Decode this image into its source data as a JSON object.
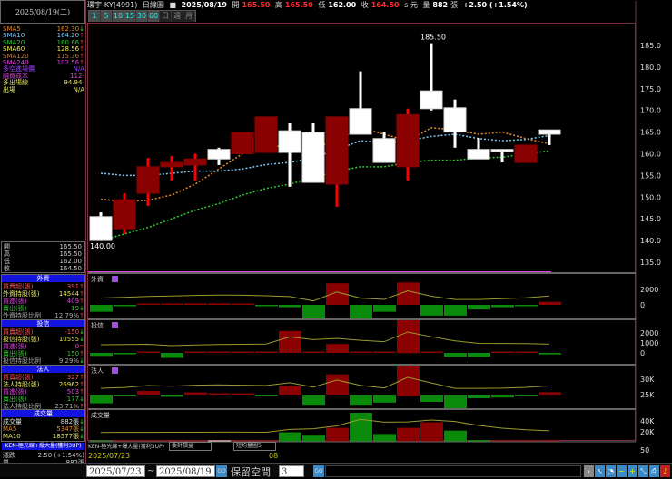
{
  "header": {
    "stock": "環宇-KY(4991)",
    "chart_type": "日線圖",
    "icon": "■",
    "date": "2025/08/19",
    "open_label": "開",
    "open": "165.50",
    "high_label": "高",
    "high": "165.50",
    "low_label": "低",
    "low": "162.00",
    "close_label": "收",
    "close": "164.50",
    "unit": "s 元",
    "vol_label": "量",
    "vol": "882",
    "vol_unit": "張",
    "change": "+2.50 (+1.54%)"
  },
  "periods": [
    "1",
    "5",
    "10",
    "15",
    "30",
    "60",
    "日",
    "週",
    "月"
  ],
  "left": {
    "date": "2025/08/19(二)",
    "ma": [
      {
        "label": "SMA5",
        "value": "162.30",
        "arrow": "↓",
        "color": "#e08a2a"
      },
      {
        "label": "SMA10",
        "value": "164.20",
        "arrow": "↑",
        "color": "#7ec8f0"
      },
      {
        "label": "SMA20",
        "value": "160.66",
        "arrow": "↑",
        "color": "#2ec82e"
      },
      {
        "label": "SMA60",
        "value": "128.56",
        "arrow": "↑",
        "color": "#e8e860"
      },
      {
        "label": "SMA120",
        "value": "115.36",
        "arrow": "↑",
        "color": "#b08050"
      },
      {
        "label": "SMA240",
        "value": "102.56",
        "arrow": "↑",
        "color": "#e040e0"
      },
      {
        "label": "多空進場價",
        "value": "N/A",
        "arrow": "",
        "color": "#a040ff"
      },
      {
        "label": "融資成本",
        "value": "112",
        "arrow": "-",
        "color": "#e040e0"
      },
      {
        "label": "多出場線",
        "value": "94.94",
        "arrow": "-",
        "color": "#e8e860"
      },
      {
        "label": "出場",
        "value": "N/A",
        "arrow": "",
        "color": "#e8e860"
      }
    ],
    "ohlc": [
      {
        "label": "開",
        "value": "165.50"
      },
      {
        "label": "高",
        "value": "165.50"
      },
      {
        "label": "低",
        "value": "162.00"
      },
      {
        "label": "收",
        "value": "164.50"
      }
    ],
    "sections": [
      {
        "title": "外資",
        "rows": [
          {
            "label": "買賣超(張)",
            "value": "391",
            "arrow": "↑",
            "color": "#ff5050"
          },
          {
            "label": "外資持股(張)",
            "value": "14544",
            "arrow": "↑",
            "color": "#e8e860"
          },
          {
            "label": "買進(張)",
            "value": "409",
            "arrow": "↑",
            "color": "#e040e0"
          },
          {
            "label": "賣出(張)",
            "value": "19",
            "arrow": "↓",
            "color": "#2ec82e"
          },
          {
            "label": "外資持股比例",
            "value": "12.79%",
            "arrow": "↑",
            "color": "#aaa"
          }
        ]
      },
      {
        "title": "投信",
        "rows": [
          {
            "label": "買賣超(張)",
            "value": "-150",
            "arrow": "↓",
            "color": "#ff5050"
          },
          {
            "label": "投信持股(張)",
            "value": "10555",
            "arrow": "↓",
            "color": "#e8e860"
          },
          {
            "label": "買進(張)",
            "value": "0",
            "arrow": "=",
            "color": "#e040e0"
          },
          {
            "label": "賣出(張)",
            "value": "150",
            "arrow": "↑",
            "color": "#2ec82e"
          },
          {
            "label": "投信持股比例",
            "value": "9.29%",
            "arrow": "↓",
            "color": "#aaa"
          }
        ]
      },
      {
        "title": "法人",
        "rows": [
          {
            "label": "買賣超(張)",
            "value": "327",
            "arrow": "↑",
            "color": "#ff5050"
          },
          {
            "label": "法人持股(張)",
            "value": "26962",
            "arrow": "↑",
            "color": "#e8e860"
          },
          {
            "label": "買進(張)",
            "value": "503",
            "arrow": "↑",
            "color": "#e040e0"
          },
          {
            "label": "賣出(張)",
            "value": "177",
            "arrow": "↓",
            "color": "#2ec82e"
          },
          {
            "label": "法人持股比例",
            "value": "23.71%",
            "arrow": "↑",
            "color": "#aaa"
          }
        ]
      },
      {
        "title": "成交量",
        "rows": [
          {
            "label": "成交量",
            "value": "882張",
            "arrow": "↓",
            "color": "#ddd"
          },
          {
            "label": "MA5",
            "value": "5347張",
            "arrow": "↓",
            "color": "#e08a2a"
          },
          {
            "label": "MA10",
            "value": "18577張",
            "arrow": "↓",
            "color": "#e8e860"
          }
        ]
      }
    ],
    "strategy": "KEN-極光線+爆大量(獲利3UP)",
    "summary": [
      {
        "label": "漲跌",
        "value": "2.50 (+1.54%)"
      },
      {
        "label": "量",
        "value": "882張"
      }
    ]
  },
  "panels": {
    "foreign": "外資",
    "trust": "投信",
    "inst": "法人",
    "volume": "成交量"
  },
  "indicator_bar": {
    "strategy": "KEN-極光線+爆大量(獲利3UP)",
    "select1": "委計損益",
    "select2": "短均量圖5"
  },
  "x_axis": {
    "start": "2025/07/23",
    "mid": "08"
  },
  "bottom": {
    "from": "2025/07/23",
    "tilde": "~",
    "to": "2025/08/19",
    "go": "GO",
    "reserve_label": "保留空間",
    "reserve_value": "3"
  },
  "chart_data": {
    "type": "candlestick",
    "price_ylim": [
      133,
      188
    ],
    "price_ticks": [
      "185.0",
      "180.0",
      "175.0",
      "170.0",
      "165.0",
      "160.0",
      "155.0",
      "150.0",
      "145.0",
      "140.0",
      "135.0"
    ],
    "high_label": "185.50",
    "low_label": "140.00",
    "candles": [
      {
        "o": 140,
        "h": 146.5,
        "l": 140,
        "c": 145.5,
        "color": "white"
      },
      {
        "o": 149.4,
        "h": 150.9,
        "l": 141.5,
        "c": 142.7,
        "color": "red"
      },
      {
        "o": 157,
        "h": 159,
        "l": 148,
        "c": 150.9,
        "color": "red"
      },
      {
        "o": 158,
        "h": 159.5,
        "l": 153.8,
        "c": 157,
        "color": "red"
      },
      {
        "o": 158.8,
        "h": 160,
        "l": 153.8,
        "c": 157.4,
        "color": "red"
      },
      {
        "o": 158.8,
        "h": 161.4,
        "l": 157.4,
        "c": 161,
        "color": "white"
      },
      {
        "o": 164.9,
        "h": 164.9,
        "l": 160,
        "c": 160,
        "color": "red"
      },
      {
        "o": 168.5,
        "h": 168.5,
        "l": 160.3,
        "c": 160.3,
        "color": "red"
      },
      {
        "o": 160.3,
        "h": 167,
        "l": 152.4,
        "c": 165.3,
        "color": "white"
      },
      {
        "o": 153.4,
        "h": 167,
        "l": 153.4,
        "c": 164.9,
        "color": "white"
      },
      {
        "o": 168.5,
        "h": 168.5,
        "l": 147.8,
        "c": 153,
        "color": "red"
      },
      {
        "o": 164.5,
        "h": 179,
        "l": 164.5,
        "c": 170.4,
        "color": "white"
      },
      {
        "o": 158,
        "h": 165,
        "l": 158,
        "c": 163.5,
        "color": "white"
      },
      {
        "o": 169,
        "h": 170.4,
        "l": 153.8,
        "c": 157,
        "color": "red"
      },
      {
        "o": 170.4,
        "h": 185.5,
        "l": 170,
        "c": 174.5,
        "color": "white"
      },
      {
        "o": 165,
        "h": 172.5,
        "l": 161.4,
        "c": 170.6,
        "color": "white"
      },
      {
        "o": 158.8,
        "h": 163.6,
        "l": 158.8,
        "c": 161,
        "color": "white"
      },
      {
        "o": 161,
        "h": 161,
        "l": 158,
        "c": 161,
        "color": "white"
      },
      {
        "o": 162,
        "h": 162,
        "l": 158,
        "c": 158,
        "color": "red"
      },
      {
        "o": 164.5,
        "h": 165.5,
        "l": 162,
        "c": 165.5,
        "color": "white"
      }
    ],
    "sma5": [
      149.5,
      149,
      149.3,
      150.5,
      153,
      156.5,
      160,
      161.5,
      162,
      161.5,
      163,
      166,
      164.5,
      163,
      166,
      165.5,
      164.5,
      165,
      163.5,
      162.3
    ],
    "sma10": [
      155.5,
      155,
      155,
      155.5,
      156,
      156,
      156.5,
      157.5,
      158,
      159,
      161,
      163,
      162.5,
      163,
      164,
      164.5,
      163.5,
      163,
      163.3,
      164.2
    ],
    "sma20": [
      140,
      141.5,
      143,
      145,
      147,
      148.5,
      150.5,
      152,
      153,
      154.5,
      156,
      157,
      157,
      158,
      158.5,
      158.5,
      159,
      159.2,
      160,
      160.66
    ],
    "foreign_net": [
      -900,
      -100,
      100,
      100,
      200,
      200,
      50,
      -150,
      -300,
      -1900,
      2800,
      -1900,
      -900,
      2900,
      -1400,
      -1400,
      -600,
      -300,
      -100,
      391
    ],
    "foreign_ticks": [
      "2000",
      "0"
    ],
    "trust_net": [
      -300,
      -50,
      0,
      -500,
      0,
      0,
      0,
      0,
      2200,
      20,
      900,
      100,
      0,
      3300,
      0,
      -400,
      -400,
      0,
      0,
      -150
    ],
    "trust_ticks": [
      "2000",
      "1000",
      "0"
    ],
    "inst_net": [
      -1200,
      -100,
      500,
      -300,
      300,
      200,
      0,
      -100,
      1200,
      -1400,
      2800,
      -1400,
      -1100,
      4200,
      -1000,
      -1900,
      -500,
      -400,
      -100,
      327
    ],
    "inst_ticks": [
      "30K",
      "25K"
    ],
    "volume": [
      1500,
      1000,
      1000,
      1000,
      1000,
      2000,
      1000,
      1000,
      17000,
      11000,
      25000,
      52000,
      14000,
      25000,
      35000,
      20000,
      3000,
      1000,
      1000,
      882
    ],
    "volume_colors": [
      "green",
      "red",
      "red",
      "red",
      "red",
      "white",
      "red",
      "red",
      "green",
      "green",
      "red",
      "green",
      "green",
      "red",
      "red",
      "green",
      "green",
      "red",
      "red",
      "red"
    ],
    "volume_ticks": [
      "40K",
      "20K",
      "50"
    ]
  },
  "colors": {
    "up_bar": "#8b0000",
    "down_bar": "#0a8a0a",
    "wick_red": "#ff0000",
    "sma5": "#e08a2a",
    "sma10": "#7ec8f0",
    "sma20": "#2ec82e",
    "header_blue": "#1414e0"
  }
}
